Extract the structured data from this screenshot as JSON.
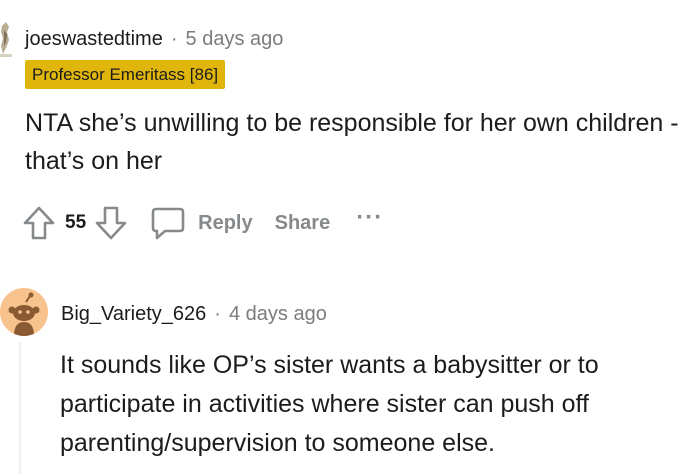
{
  "comments": [
    {
      "username": "joeswastedtime",
      "separator": "·",
      "timestamp": "5 days ago",
      "flair": "Professor Emeritass [86]",
      "body": "NTA she’s unwilling to be responsible for her own children - that’s on her",
      "votes": "55",
      "actions": {
        "reply": "Reply",
        "share": "Share",
        "more": "···"
      }
    },
    {
      "username": "Big_Variety_626",
      "separator": "·",
      "timestamp": "4 days ago",
      "body": "It sounds like OP’s sister wants a babysitter or to participate in activities where sister can push off parenting/supervision to someone else."
    }
  ],
  "icons": {
    "upvote": "upvote-icon",
    "downvote": "downvote-icon",
    "reply": "comment-bubble-icon",
    "more": "more-options-icon"
  },
  "colors": {
    "flair_background": "#e0b60c",
    "muted_text": "#878a8c",
    "timestamp_text": "#7c7c7c",
    "avatar_background": "#f8c38c"
  }
}
